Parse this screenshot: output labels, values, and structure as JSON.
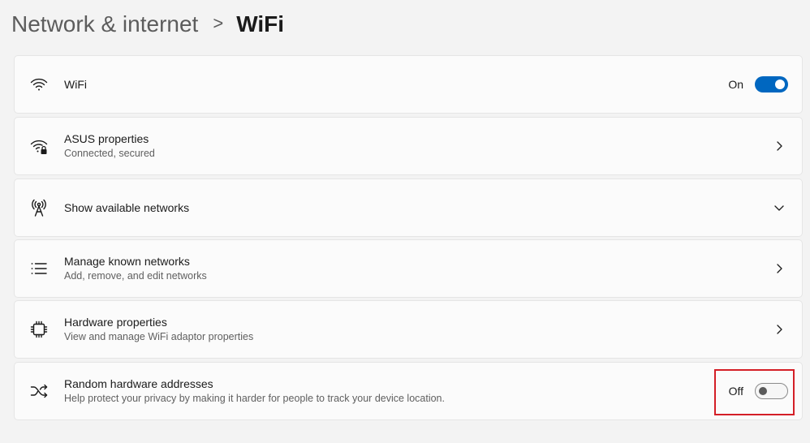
{
  "breadcrumb": {
    "parent": "Network & internet",
    "separator": ">",
    "current": "WiFi"
  },
  "rows": [
    {
      "icon": "wifi-icon",
      "title": "WiFi",
      "toggle_state": "On",
      "toggle_on": true
    },
    {
      "icon": "wifi-lock-icon",
      "title": "ASUS properties",
      "subtitle": "Connected, secured",
      "trailing": "chevron-right-icon"
    },
    {
      "icon": "antenna-icon",
      "title": "Show available networks",
      "trailing": "chevron-down-icon"
    },
    {
      "icon": "list-icon",
      "title": "Manage known networks",
      "subtitle": "Add, remove, and edit networks",
      "trailing": "chevron-right-icon"
    },
    {
      "icon": "chip-icon",
      "title": "Hardware properties",
      "subtitle": "View and manage WiFi adaptor properties",
      "trailing": "chevron-right-icon"
    },
    {
      "icon": "shuffle-icon",
      "title": "Random hardware addresses",
      "subtitle": "Help protect your privacy by making it harder for people to track your device location.",
      "toggle_state": "Off",
      "toggle_on": false,
      "highlighted": true
    }
  ],
  "colors": {
    "accent": "#0067c0",
    "highlight_box": "#d41f27",
    "background": "#f3f3f3",
    "card": "#fbfbfb"
  }
}
